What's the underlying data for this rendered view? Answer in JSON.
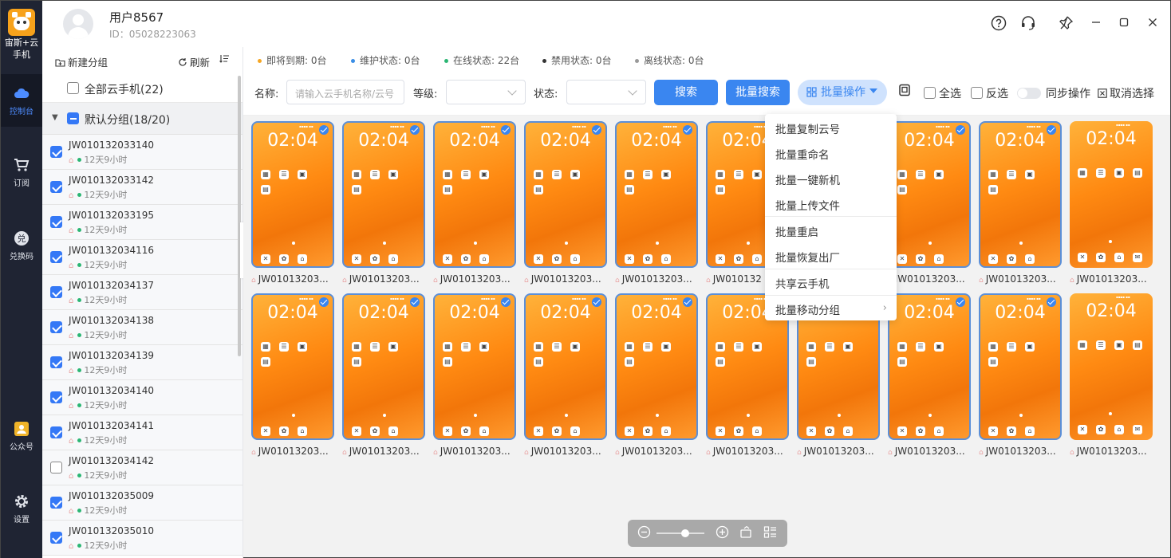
{
  "app": {
    "name": "宙斯+云手机",
    "logo_sub": "宙斯+云"
  },
  "rail": [
    {
      "label": "控制台",
      "icon": "cloud-icon",
      "active": true
    },
    {
      "label": "订阅",
      "icon": "cart-icon",
      "active": false
    },
    {
      "label": "兑换码",
      "icon": "exchange-icon",
      "active": false
    },
    {
      "label": "公众号",
      "icon": "account-icon",
      "active": false
    },
    {
      "label": "设置",
      "icon": "gear-icon",
      "active": false
    }
  ],
  "user": {
    "name": "用户8567",
    "id": "ID：05028223063"
  },
  "window_controls": [
    "help-icon",
    "support-icon",
    "pin-icon",
    "minimize-icon",
    "maximize-icon",
    "close-icon"
  ],
  "groups_panel": {
    "new_group": "新建分组",
    "refresh": "刷新",
    "all_phones": "全部云手机(22)",
    "default_group": "默认分组(18/20)",
    "devices": [
      {
        "name": "JW010132033140",
        "time": "12天9小时",
        "checked": true
      },
      {
        "name": "JW010132033142",
        "time": "12天9小时",
        "checked": true
      },
      {
        "name": "JW010132033195",
        "time": "12天9小时",
        "checked": true
      },
      {
        "name": "JW010132034116",
        "time": "12天9小时",
        "checked": true
      },
      {
        "name": "JW010132034137",
        "time": "12天9小时",
        "checked": true
      },
      {
        "name": "JW010132034138",
        "time": "12天9小时",
        "checked": true
      },
      {
        "name": "JW010132034139",
        "time": "12天9小时",
        "checked": true
      },
      {
        "name": "JW010132034140",
        "time": "12天9小时",
        "checked": true
      },
      {
        "name": "JW010132034141",
        "time": "12天9小时",
        "checked": true
      },
      {
        "name": "JW010132034142",
        "time": "12天9小时",
        "checked": false
      },
      {
        "name": "JW010132035009",
        "time": "12天9小时",
        "checked": true
      },
      {
        "name": "JW010132035010",
        "time": "12天9小时",
        "checked": true
      }
    ]
  },
  "status": [
    {
      "label": "即将到期: 0台",
      "color": "#f5a623"
    },
    {
      "label": "维护状态: 0台",
      "color": "#3a8ee6"
    },
    {
      "label": "在线状态: 22台",
      "color": "#2bb673"
    },
    {
      "label": "禁用状态: 0台",
      "color": "#333333"
    },
    {
      "label": "离线状态: 0台",
      "color": "#999999"
    }
  ],
  "filters": {
    "name_label": "名称:",
    "name_placeholder": "请输入云手机名称/云号",
    "level_label": "等级:",
    "state_label": "状态:",
    "search": "搜索",
    "batch_search": "批量搜索",
    "batch_ops": "批量操作",
    "select_all": "全选",
    "invert": "反选",
    "sync": "同步操作",
    "cancel_select": "取消选择"
  },
  "phone_screen": {
    "time": "02:04"
  },
  "phones": [
    {
      "name": "JW01013203...",
      "selected": true
    },
    {
      "name": "JW01013203...",
      "selected": true
    },
    {
      "name": "JW01013203...",
      "selected": true
    },
    {
      "name": "JW01013203...",
      "selected": true
    },
    {
      "name": "JW01013203...",
      "selected": true
    },
    {
      "name": "JW010132",
      "selected": true
    },
    {
      "name": "JW01013203...",
      "selected": true
    },
    {
      "name": "JW01013203...",
      "selected": true
    },
    {
      "name": "JW01013203...",
      "selected": true
    },
    {
      "name": "JW01013203...",
      "selected": false
    },
    {
      "name": "JW01013203...",
      "selected": true
    },
    {
      "name": "JW01013203...",
      "selected": true
    },
    {
      "name": "JW01013203...",
      "selected": true
    },
    {
      "name": "JW01013203...",
      "selected": true
    },
    {
      "name": "JW01013203...",
      "selected": true
    },
    {
      "name": "JW01013203...",
      "selected": true
    },
    {
      "name": "JW01013203...",
      "selected": true
    },
    {
      "name": "JW01013203...",
      "selected": true
    },
    {
      "name": "JW01013203...",
      "selected": true
    },
    {
      "name": "JW01013203...",
      "selected": false
    }
  ],
  "batch_menu": [
    "批量复制云号",
    "批量重命名",
    "批量一键新机",
    "批量上传文件",
    "批量重启",
    "批量恢复出厂",
    "共享云手机",
    "批量移动分组"
  ],
  "zoom_bar": [
    "zoom-out-icon",
    "zoom-slider",
    "zoom-in-icon",
    "rotate-icon",
    "layout-icon"
  ]
}
